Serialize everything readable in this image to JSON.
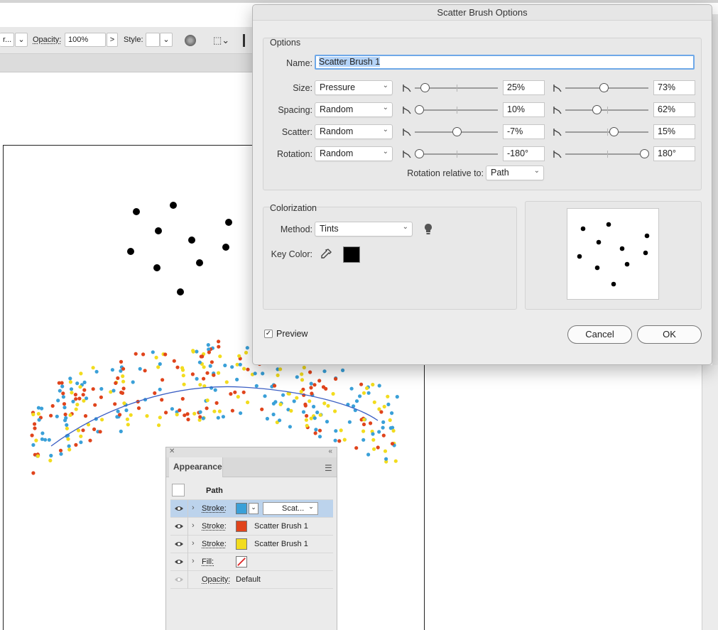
{
  "control_bar": {
    "left_fragment": "r...",
    "opacity_label": "Opacity:",
    "opacity_value": "100%",
    "style_label": "Style:",
    "more_chev": ">"
  },
  "dialog": {
    "title": "Scatter Brush Options",
    "options_group_label": "Options",
    "name_label": "Name:",
    "name_value": "Scatter Brush 1",
    "rows": [
      {
        "label": "Size:",
        "method": "Pressure",
        "min_value": "25%",
        "max_value": "73%",
        "min_pos": 0.12,
        "max_pos": 0.46
      },
      {
        "label": "Spacing:",
        "method": "Random",
        "min_value": "10%",
        "max_value": "62%",
        "min_pos": 0.05,
        "max_pos": 0.38
      },
      {
        "label": "Scatter:",
        "method": "Random",
        "min_value": "-7%",
        "max_value": "15%",
        "min_pos": 0.5,
        "max_pos": 0.58
      },
      {
        "label": "Rotation:",
        "method": "Random",
        "min_value": "-180°",
        "max_value": "180°",
        "min_pos": 0.05,
        "max_pos": 0.95
      }
    ],
    "rotation_relative_label": "Rotation relative to:",
    "rotation_relative_value": "Path",
    "colorization_group_label": "Colorization",
    "method_label": "Method:",
    "method_value": "Tints",
    "key_color_label": "Key Color:",
    "key_color": "#000000",
    "preview_label": "Preview",
    "preview_checked": true,
    "cancel_label": "Cancel",
    "ok_label": "OK"
  },
  "appearance_panel": {
    "tab_label": "Appearance",
    "path_label": "Path",
    "rows": [
      {
        "label": "Stroke:",
        "swatch_color": "#3aa0d8",
        "brush": "Scat...",
        "selected": true
      },
      {
        "label": "Stroke:",
        "swatch_color": "#e0441c",
        "brush": "Scatter Brush 1",
        "selected": false
      },
      {
        "label": "Stroke:",
        "swatch_color": "#f2dc1e",
        "brush": "Scatter Brush 1",
        "selected": false
      },
      {
        "label": "Fill:",
        "swatch_color": "none",
        "brush": "",
        "selected": false
      }
    ],
    "opacity_label": "Opacity:",
    "opacity_value": "Default"
  },
  "colors": {
    "dot_blue": "#3aa0d8",
    "dot_red": "#e0441c",
    "dot_yellow": "#f2dc1e",
    "path_stroke": "#3b5fc4",
    "selection_blue": "#bcd3ec"
  }
}
